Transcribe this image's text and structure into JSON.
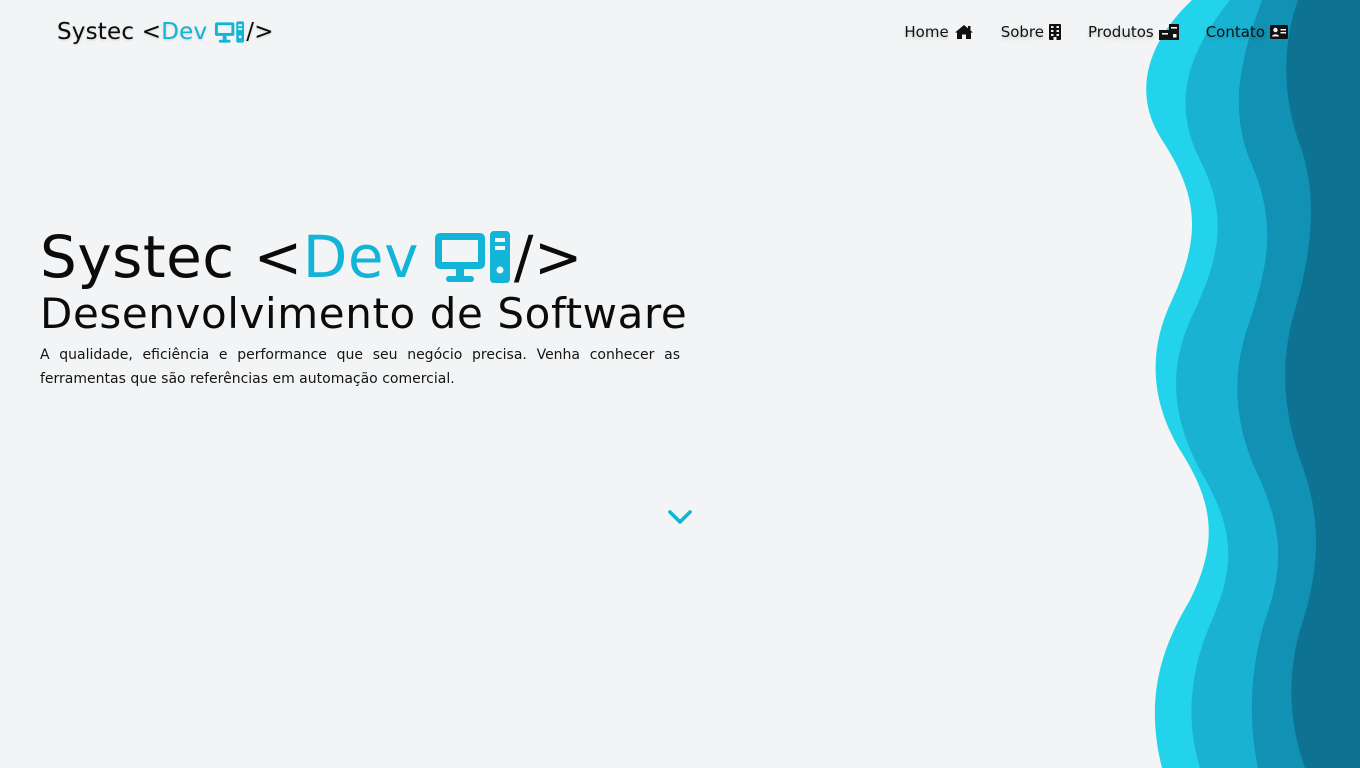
{
  "colors": {
    "background": "#f2f4f5",
    "accent": "#12b4d8",
    "text": "#0b0b0b",
    "wave_light": "#22d3eb",
    "wave_mid": "#19b2d3",
    "wave_dark": "#1191b3",
    "wave_darkest": "#0e7392"
  },
  "brand": {
    "prefix": "Systec <",
    "accent": "Dev",
    "icon": "desktop-pc-icon",
    "suffix": "/>"
  },
  "nav": {
    "items": [
      {
        "label": "Home",
        "icon": "home-icon"
      },
      {
        "label": "Sobre",
        "icon": "building-icon"
      },
      {
        "label": "Produtos",
        "icon": "boxes-icon"
      },
      {
        "label": "Contato",
        "icon": "address-card-icon"
      }
    ]
  },
  "hero": {
    "title_prefix": "Systec <",
    "title_accent": "Dev",
    "title_icon": "desktop-pc-icon",
    "title_suffix": "/>",
    "subtitle": "Desenvolvimento de Software",
    "description": "A qualidade, eficiência e performance que seu negócio precisa. Venha conhecer as ferramentas que são referências em automação comercial."
  },
  "scroll_indicator": {
    "icon": "chevron-down-icon"
  }
}
